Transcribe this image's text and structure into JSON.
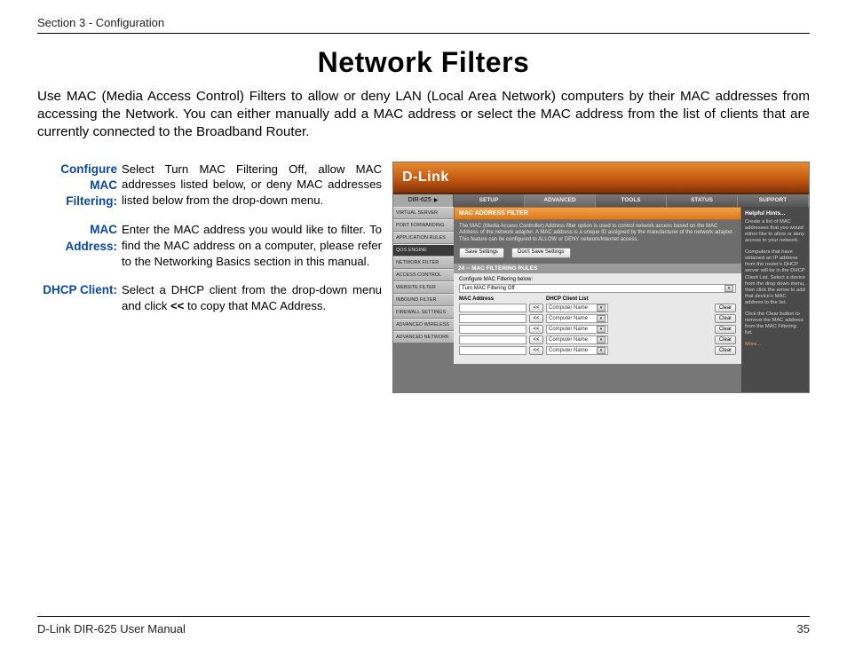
{
  "header": {
    "section": "Section 3 - Configuration"
  },
  "title": "Network Filters",
  "intro": "Use MAC (Media Access Control) Filters to allow or deny LAN (Local Area Network) computers by their MAC addresses from accessing the Network. You can either manually add a MAC address or select the MAC address from the list of clients that are currently connected to the Broadband Router.",
  "defs": {
    "cfg_label": "Configure MAC Filtering:",
    "cfg_text": "Select Turn MAC Filtering Off, allow MAC addresses listed below, or deny MAC addresses listed below from the drop-down menu.",
    "mac_label": "MAC Address:",
    "mac_text": "Enter the MAC address you would like to filter. To find the MAC address on a computer, please refer to the Networking Basics section in this manual.",
    "dhcp_label": "DHCP Client:",
    "dhcp_text_a": "Select a DHCP client from the drop-down menu and click ",
    "dhcp_bold": "<<",
    "dhcp_text_b": " to copy that MAC Address."
  },
  "shot": {
    "brand": "D-Link",
    "product": "DIR-625",
    "tabs": [
      "SETUP",
      "ADVANCED",
      "TOOLS",
      "STATUS",
      "SUPPORT"
    ],
    "active_tab": 1,
    "side": [
      "VIRTUAL SERVER",
      "PORT FORWARDING",
      "APPLICATION RULES",
      "QOS ENGINE",
      "NETWORK FILTER",
      "ACCESS CONTROL",
      "WEBSITE FILTER",
      "INBOUND FILTER",
      "FIREWALL SETTINGS",
      "ADVANCED WIRELESS",
      "ADVANCED NETWORK"
    ],
    "panel_title": "MAC ADDRESS FILTER",
    "panel_desc": "The MAC (Media Access Controller) Address filter option is used to control network access based on the MAC Address of the network adapter. A MAC address is a unique ID assigned by the manufacturer of the network adapter. This feature can be configured to ALLOW or DENY network/Internet access.",
    "save": "Save Settings",
    "dontsave": "Don't Save Settings",
    "rules_title": "24 -- MAC FILTERING RULES",
    "cfg_below": "Configure MAC Filtering below:",
    "cfg_option": "Turn MAC Filtering Off",
    "col_mac": "MAC Address",
    "col_dhcp": "DHCP Client List",
    "copy": "<<",
    "cname": "Computer Name",
    "clear": "Clear",
    "rows": 5,
    "hints_title": "Helpful Hints...",
    "hint1": "Create a list of MAC addresses that you would either like to allow or deny access to your network.",
    "hint2": "Computers that have obtained an IP address from the router's DHCP server will be in the DHCP Client List. Select a device from the drop down menu, then click the arrow to add that device's MAC address to the list.",
    "hint3": "Click the Clear button to remove the MAC address from the MAC Filtering list.",
    "more": "More..."
  },
  "footer": {
    "left": "D-Link DIR-625 User Manual",
    "page": "35"
  }
}
